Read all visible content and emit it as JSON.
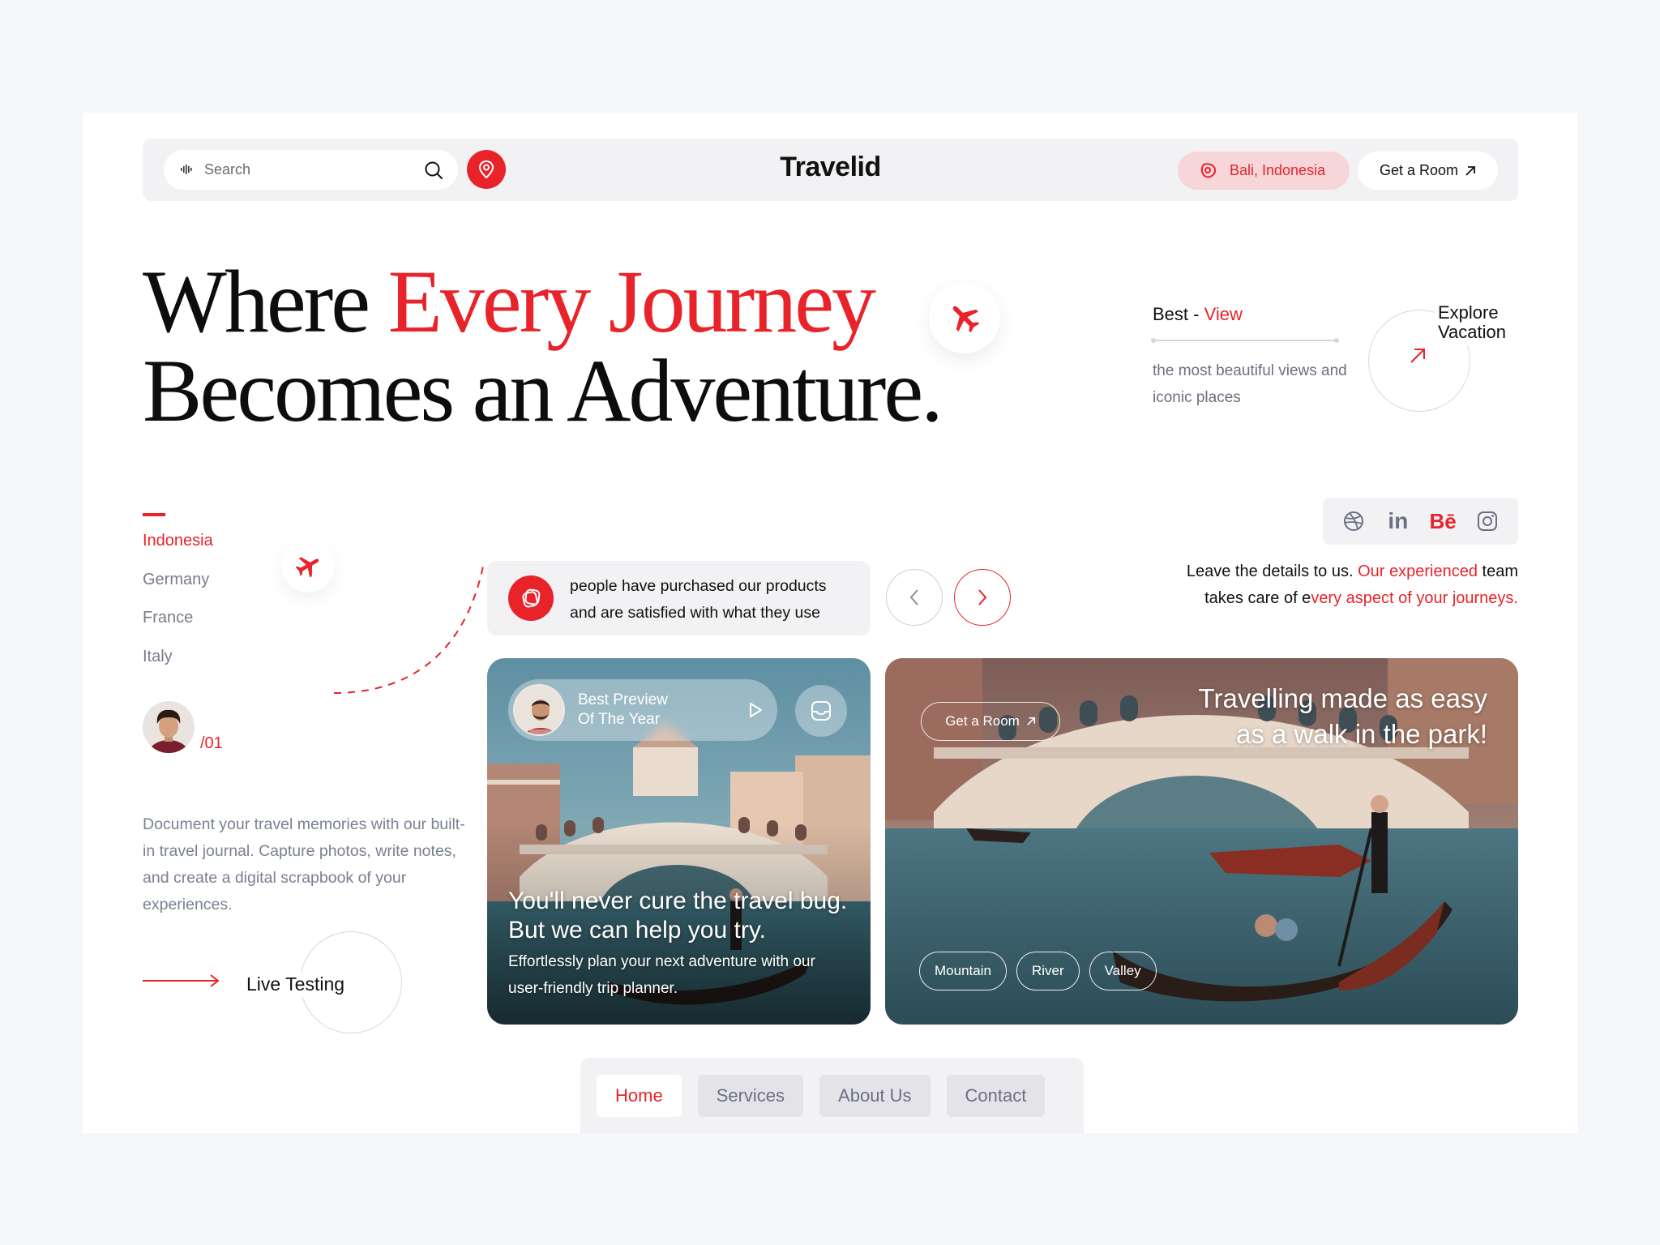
{
  "header": {
    "search_placeholder": "Search",
    "brand": "Travelid",
    "location": "Bali, Indonesia",
    "cta": "Get a Room"
  },
  "hero": {
    "line1_a": "Where ",
    "line1_b": "Every Journey",
    "line2": "Becomes an Adventure."
  },
  "best_view": {
    "title_a": "Best - ",
    "title_b": "View",
    "desc": "the most beautiful views and iconic places"
  },
  "explore": {
    "label_1": "Explore",
    "label_2": "Vacation"
  },
  "countries": [
    "Indonesia",
    "Germany",
    "France",
    "Italy"
  ],
  "avatar_count": "/01",
  "doc_text": "Document your travel memories with our built-in travel journal. Capture photos, write notes, and create a digital scrapbook of your experiences.",
  "live_testing": "Live Testing",
  "purchase": {
    "line1": "people have purchased our products",
    "line2": "and are satisfied with what they use"
  },
  "tagline": {
    "p1": "Leave the details to us. ",
    "p2": "Our experienced",
    "p3": " team",
    "p4": "takes care of e",
    "p5": "very aspect of your journeys."
  },
  "card_left": {
    "preview_1": "Best Preview",
    "preview_2": "Of The Year",
    "head_1": "You'll never cure the travel bug.",
    "head_2": "But we can help you try.",
    "sub": "Effortlessly plan your next adventure with our user-friendly trip planner."
  },
  "card_right": {
    "chip": "Get a Room",
    "head_1": "Travelling made as easy",
    "head_2": "as a walk in the park!",
    "tags": [
      "Mountain",
      "River",
      "Valley"
    ]
  },
  "bottom_nav": [
    "Home",
    "Services",
    "About Us",
    "Contact"
  ],
  "colors": {
    "accent": "#e8232a",
    "muted": "#6b6f80",
    "panel": "#f2f2f4"
  },
  "icons": [
    "mic-icon",
    "search-icon",
    "location-pin-icon",
    "arrow-up-right-icon",
    "airplane-icon",
    "play-icon",
    "inbox-icon",
    "chevron-left-icon",
    "chevron-right-icon",
    "dribbble-icon",
    "linkedin-icon",
    "behance-icon",
    "instagram-icon",
    "arrow-right-icon"
  ]
}
